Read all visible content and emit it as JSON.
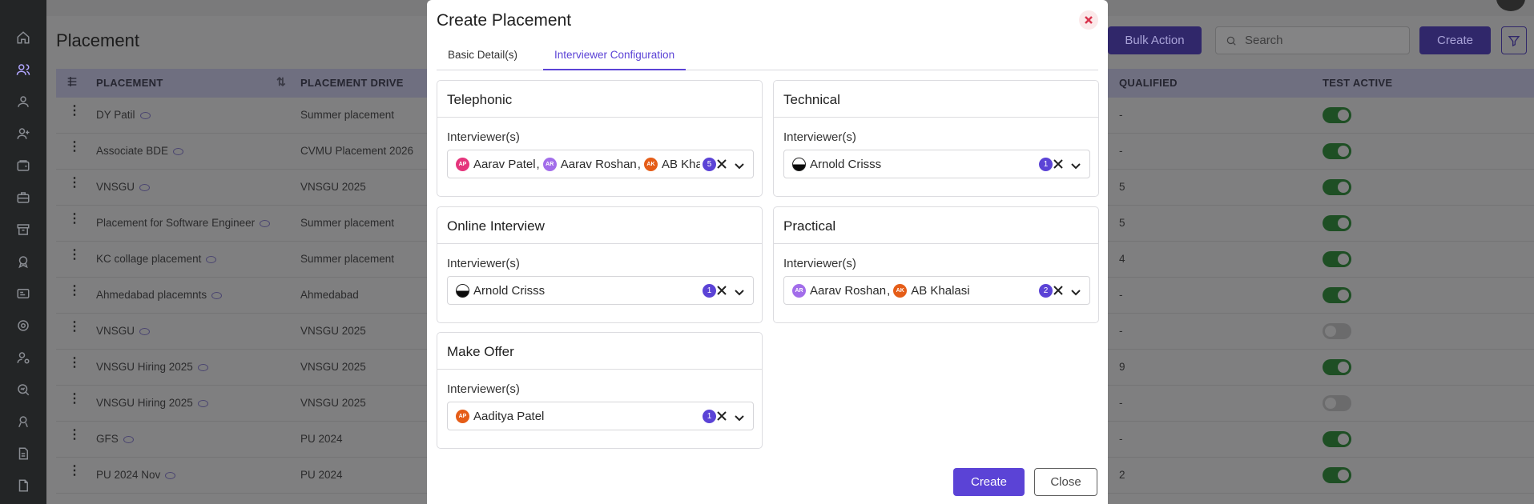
{
  "page": {
    "title": "Placement",
    "bulk_action": "Bulk Action",
    "search_placeholder": "Search",
    "create_label": "Create"
  },
  "table": {
    "columns": {
      "placement": "PLACEMENT",
      "drive": "PLACEMENT DRIVE",
      "qualified": "QUALIFIED",
      "test_active": "TEST ACTIVE"
    },
    "rows": [
      {
        "placement": "DY Patil",
        "drive": "Summer placement",
        "qualified": "-",
        "test_active": true
      },
      {
        "placement": "Associate BDE",
        "drive": "CVMU Placement 2026",
        "qualified": "-",
        "test_active": true
      },
      {
        "placement": "VNSGU",
        "drive": "VNSGU 2025",
        "qualified": "5",
        "test_active": true
      },
      {
        "placement": "Placement for Software Engineer",
        "drive": "Summer placement",
        "qualified": "5",
        "test_active": true
      },
      {
        "placement": "KC collage placement",
        "drive": "Summer placement",
        "qualified": "4",
        "test_active": true
      },
      {
        "placement": "Ahmedabad placemnts",
        "drive": "Ahmedabad",
        "qualified": "-",
        "test_active": true
      },
      {
        "placement": "VNSGU",
        "drive": "VNSGU 2025",
        "qualified": "-",
        "test_active": false
      },
      {
        "placement": "VNSGU Hiring 2025",
        "drive": "VNSGU 2025",
        "qualified": "9",
        "test_active": true
      },
      {
        "placement": "VNSGU Hiring 2025",
        "drive": "VNSGU 2025",
        "qualified": "-",
        "test_active": false
      },
      {
        "placement": "GFS",
        "drive": "PU 2024",
        "qualified": "-",
        "test_active": true
      },
      {
        "placement": "PU 2024 Nov",
        "drive": "PU 2024",
        "qualified": "2",
        "test_active": true
      }
    ]
  },
  "modal": {
    "title": "Create Placement",
    "tabs": [
      "Basic Detail(s)",
      "Interviewer Configuration"
    ],
    "active_tab": "Interviewer Configuration",
    "interviewer_label": "Interviewer(s)",
    "create_button": "Create",
    "close_button": "Close",
    "sections": [
      {
        "title": "Telephonic",
        "chips": [
          {
            "initials": "AP",
            "name": "Aarav Patel",
            "color": "#e5357c"
          },
          {
            "initials": "AR",
            "name": "Aarav Roshan",
            "color": "#a26dea"
          },
          {
            "initials": "AK",
            "name": "AB Khalasi",
            "color": "#e55d18"
          }
        ],
        "count": "5"
      },
      {
        "title": "Technical",
        "chips": [
          {
            "initials": "",
            "name": "Arnold Crisss",
            "color": "photo"
          }
        ],
        "count": "1"
      },
      {
        "title": "Online Interview",
        "chips": [
          {
            "initials": "",
            "name": "Arnold Crisss",
            "color": "photo"
          }
        ],
        "count": "1"
      },
      {
        "title": "Practical",
        "chips": [
          {
            "initials": "AR",
            "name": "Aarav Roshan",
            "color": "#a26dea"
          },
          {
            "initials": "AK",
            "name": "AB Khalasi",
            "color": "#e55d18"
          }
        ],
        "count": "2"
      },
      {
        "title": "Make Offer",
        "chips": [
          {
            "initials": "AP",
            "name": "Aaditya Patel",
            "color": "#e55d18"
          }
        ],
        "count": "1"
      }
    ]
  }
}
